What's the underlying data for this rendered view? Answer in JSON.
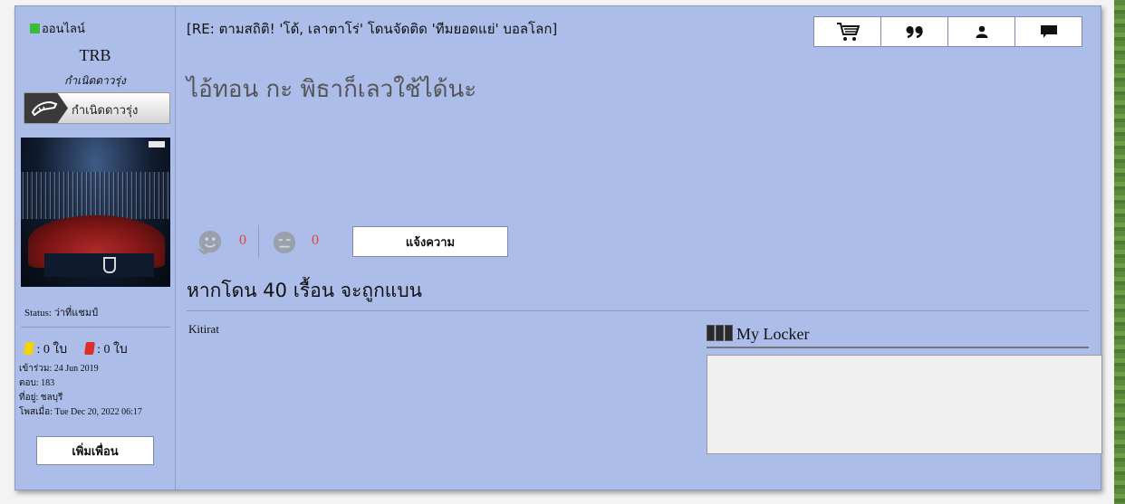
{
  "sidebar": {
    "online_status": "ออนไลน์",
    "username": "TRB",
    "rank_title": "กำเนิดดาวรุ่ง",
    "rank_badge_label": "กำเนิดดาวรุ่ง",
    "status_text": "Status: ว่าที่แชมป์",
    "yellow_cards": ": 0 ใบ",
    "red_cards": ": 0 ใบ",
    "joined": "เข้าร่วม: 24 Jun 2019",
    "replies": "ตอบ: 183",
    "location": "ที่อยู่: ชลบุรี",
    "posted_at": "โพสเมื่อ: Tue Dec 20, 2022 06:17",
    "add_friend_label": "เพิ่มเพื่อน"
  },
  "post": {
    "title": "[RE: ตามสถิติ! 'โด้, เลาตาโร่' โดนจัดติด 'ทีมยอดแย่' บอลโลก]",
    "body": "ไอ้ทอน กะ พิธาก็เลวใช้ได้นะ",
    "like_count": "0",
    "dislike_count": "0",
    "report_label": "แจ้งความ",
    "warning_text": "หากโดน 40 เรื้อน จะถูกแบน",
    "signature_name": "Kitirat",
    "locker_title": "My Locker"
  },
  "toolbar": {
    "buttons": [
      "cart-icon",
      "quote-icon",
      "user-icon",
      "message-icon"
    ]
  },
  "colors": {
    "card_bg": "#abbde8",
    "online_dot": "#3cba3c",
    "count_red": "#e04040"
  }
}
